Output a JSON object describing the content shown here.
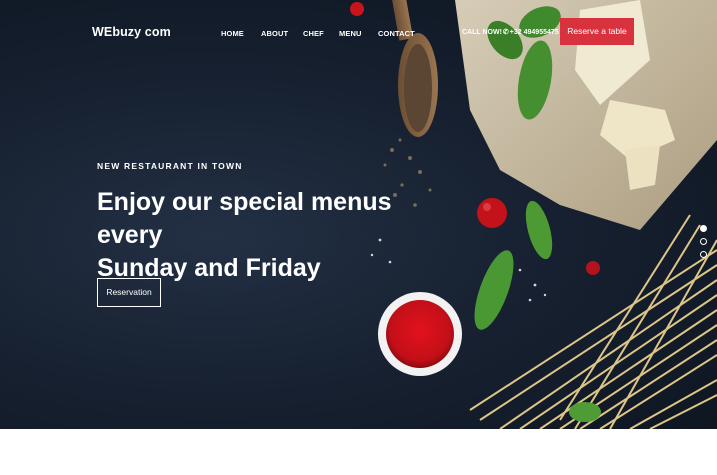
{
  "brand": {
    "logo": "WEbuzy  com"
  },
  "nav": {
    "items": [
      "HOME",
      "ABOUT",
      "CHEF",
      "MENU",
      "CONTACT"
    ]
  },
  "contact": {
    "call_label": "CALL NOW!",
    "phone": "+32 494955475"
  },
  "header": {
    "reserve_label": "Reserve a table"
  },
  "hero": {
    "eyebrow": "NEW RESTAURANT IN TOWN",
    "headline_line1": "Enjoy our special menus every",
    "headline_line2": "Sunday and Friday",
    "cta_label": "Reservation"
  },
  "slider": {
    "slide_count": 3,
    "active_index": 0
  },
  "colors": {
    "accent": "#d9323f",
    "hero_bg": "#172131",
    "text": "#ffffff"
  }
}
